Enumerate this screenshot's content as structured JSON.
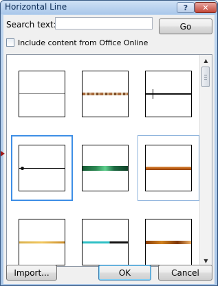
{
  "window": {
    "title": "Horizontal Line",
    "help_glyph": "?",
    "close_glyph": "✕"
  },
  "search": {
    "label": "Search text:",
    "value": "",
    "go_label": "Go"
  },
  "include_online": {
    "label": "Include content from Office Online",
    "checked": false
  },
  "gallery": {
    "items": [
      {
        "icon": "thin-gray-line-icon"
      },
      {
        "icon": "textured-brown-line-icon"
      },
      {
        "icon": "black-line-with-tick-icon"
      },
      {
        "icon": "black-line-with-dot-icon"
      },
      {
        "icon": "green-gradient-line-icon"
      },
      {
        "icon": "orange-bar-line-icon"
      },
      {
        "icon": "gold-line-icon"
      },
      {
        "icon": "teal-black-line-icon"
      },
      {
        "icon": "brown-orange-line-icon"
      }
    ]
  },
  "buttons": {
    "import_label": "Import...",
    "ok_label": "OK",
    "cancel_label": "Cancel"
  },
  "colors": {
    "selection_border": "#3d8ee6",
    "title_bar": "#bfd6ef",
    "close_button": "#c44738"
  }
}
